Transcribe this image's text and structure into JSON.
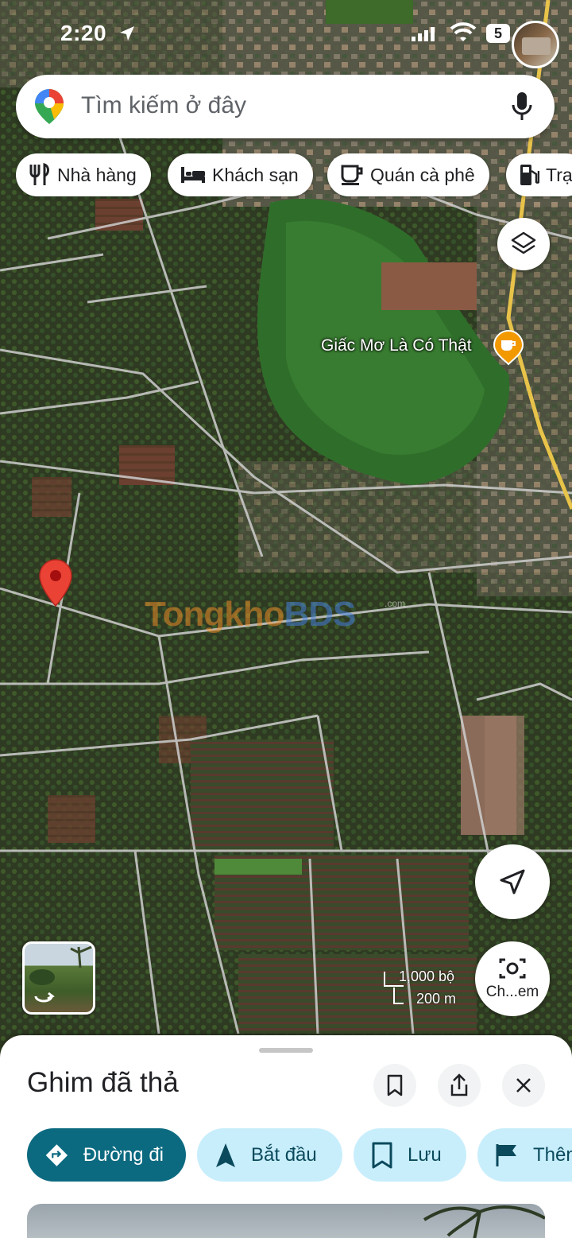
{
  "status_bar": {
    "time": "2:20",
    "battery": "5",
    "icons": [
      "location-arrow-icon",
      "signal-icon",
      "wifi-icon",
      "battery-icon",
      "avatar"
    ]
  },
  "search": {
    "placeholder": "Tìm kiếm ở đây",
    "logo_icon": "google-maps-pin-icon",
    "mic_icon": "microphone-icon"
  },
  "chips": [
    {
      "label": "Nhà hàng",
      "icon": "fork-knife-icon"
    },
    {
      "label": "Khách sạn",
      "icon": "bed-icon"
    },
    {
      "label": "Quán cà phê",
      "icon": "coffee-cup-icon"
    },
    {
      "label": "Trạ",
      "icon": "gas-pump-icon"
    }
  ],
  "map": {
    "poi_label": "Giấc Mơ Là Có Thật",
    "poi_icon": "cafe-marker-icon",
    "pin_icon": "red-pin-icon",
    "watermark_a": "Tongkho",
    "watermark_b": "BDS",
    "watermark_sub": ".com",
    "scale_imperial": "1,000 bộ",
    "scale_metric": "200 m",
    "camera_label": "Ch...em",
    "colors": {
      "pin": "#ea4335",
      "poi": "#f29900",
      "road": "#e8c34a"
    }
  },
  "sheet": {
    "title": "Ghim đã thả",
    "icons": [
      "bookmark-icon",
      "share-icon",
      "close-icon"
    ],
    "actions": [
      {
        "label": "Đường đi",
        "icon": "directions-icon"
      },
      {
        "label": "Bắt đầu",
        "icon": "navigation-arrow-icon"
      },
      {
        "label": "Lưu",
        "icon": "bookmark-icon"
      },
      {
        "label": "Thên",
        "icon": "flag-icon"
      }
    ],
    "colors": {
      "primary": "#0b6a80",
      "secondary": "#c8eefc"
    }
  }
}
